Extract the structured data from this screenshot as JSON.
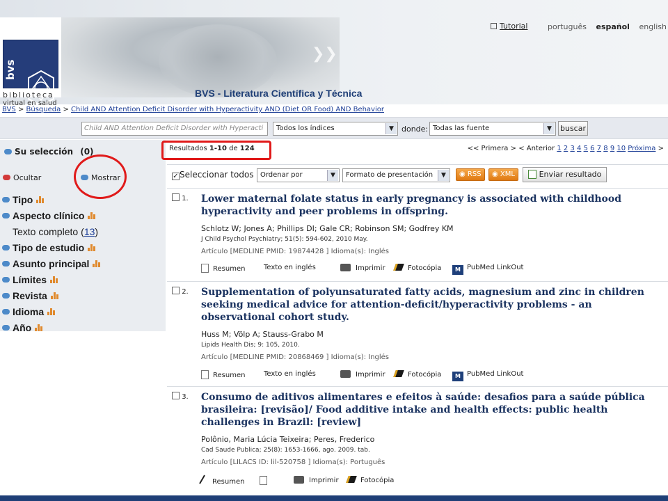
{
  "header": {
    "logo_letters": "bvs",
    "logo_line1": "biblioteca",
    "logo_line2": "virtual en salud",
    "site_title": "BVS - Literatura Científica y Técnica",
    "tutorial": "Tutorial",
    "languages": [
      "português",
      "español",
      "english"
    ]
  },
  "breadcrumb": {
    "items": [
      "BVS",
      "Búsqueda",
      "Child AND Attention Deficit Disorder with Hyperactivity AND (Diet OR Food) AND Behavior"
    ],
    "separator": ">"
  },
  "search": {
    "query": "Child AND Attention Deficit Disorder with Hyperacti",
    "index_select": "Todos los índices",
    "donde_label": "donde:",
    "source_select": "Todas las fuente",
    "button": "buscar"
  },
  "sidebar": {
    "selection": "Su selección",
    "selection_count": "(0)",
    "ocultar": "Ocultar",
    "mostrar": "Mostrar",
    "filters": [
      {
        "label": "Tipo",
        "chart": true
      },
      {
        "label": "Aspecto clínico",
        "chart": true
      },
      {
        "label": "Texto completo",
        "count": "13",
        "chart": false
      },
      {
        "label": "Tipo de estudio",
        "chart": true
      },
      {
        "label": "Asunto principal",
        "chart": true
      },
      {
        "label": "Límites",
        "chart": true
      },
      {
        "label": "Revista",
        "chart": true
      },
      {
        "label": "Idioma",
        "chart": true
      },
      {
        "label": "Año",
        "chart": true
      }
    ]
  },
  "results": {
    "label": "Resultados",
    "range": "1-10",
    "de": "de",
    "total": "124",
    "pager": {
      "first": "<< Primera",
      "sep": ">",
      "prev": "< Anterior",
      "pages": [
        "1",
        "2",
        "3",
        "4",
        "5",
        "6",
        "7",
        "8",
        "9",
        "10"
      ],
      "next": "Próxima",
      "next_suffix": ">"
    }
  },
  "toolbar": {
    "select_all": "Seleccionar todos",
    "order_select": "Ordenar por",
    "format_select": "Formato de presentación",
    "rss": "RSS",
    "xml": "XML",
    "send": "Enviar resultado"
  },
  "records": [
    {
      "num": "1.",
      "title": "Lower maternal folate status in early pregnancy is associated with childhood hyperactivity and peer problems in offspring.",
      "authors": "Schlotz W; Jones A; Phillips DI; Gale CR; Robinson SM; Godfrey KM",
      "source": "J Child Psychol Psychiatry; 51(5): 594-602, 2010 May.",
      "meta": "Artículo [MEDLINE PMID: 19874428 ] Idioma(s): Inglés",
      "actions": [
        "Resumen",
        "Texto en inglés",
        "Imprimir",
        "Fotocópia",
        "PubMed LinkOut"
      ]
    },
    {
      "num": "2.",
      "title": "Supplementation of polyunsaturated fatty acids, magnesium and zinc in children seeking medical advice for attention-deficit/hyperactivity problems - an observational cohort study.",
      "authors": "Huss M; Völp A; Stauss-Grabo M",
      "source": "Lipids Health Dis; 9: 105, 2010.",
      "meta": "Artículo [MEDLINE PMID: 20868469 ] Idioma(s): Inglés",
      "actions": [
        "Resumen",
        "Texto en inglés",
        "Imprimir",
        "Fotocópia",
        "PubMed LinkOut"
      ]
    },
    {
      "num": "3.",
      "title": "Consumo de aditivos alimentares e efeitos à saúde: desafios para a saúde pública brasileira: [revisão]/ Food additive intake and health effects: public health challenges in Brazil: [review]",
      "authors": "Polônio, Maria Lúcia Teixeira; Peres, Frederico",
      "source": "Cad Saude Publica; 25(8): 1653-1666, ago. 2009. tab.",
      "meta": "Artículo [LILACS ID: lil-520758 ] Idioma(s): Português",
      "actions": [
        "Resumen",
        "Imprimir",
        "Fotocópia"
      ]
    }
  ],
  "colors": {
    "link": "#1b3d96",
    "title": "#1b3360",
    "highlight": "#e01a1a",
    "sidebar_bg": "#eaedf1",
    "bar_accent": "#e08a2e"
  }
}
